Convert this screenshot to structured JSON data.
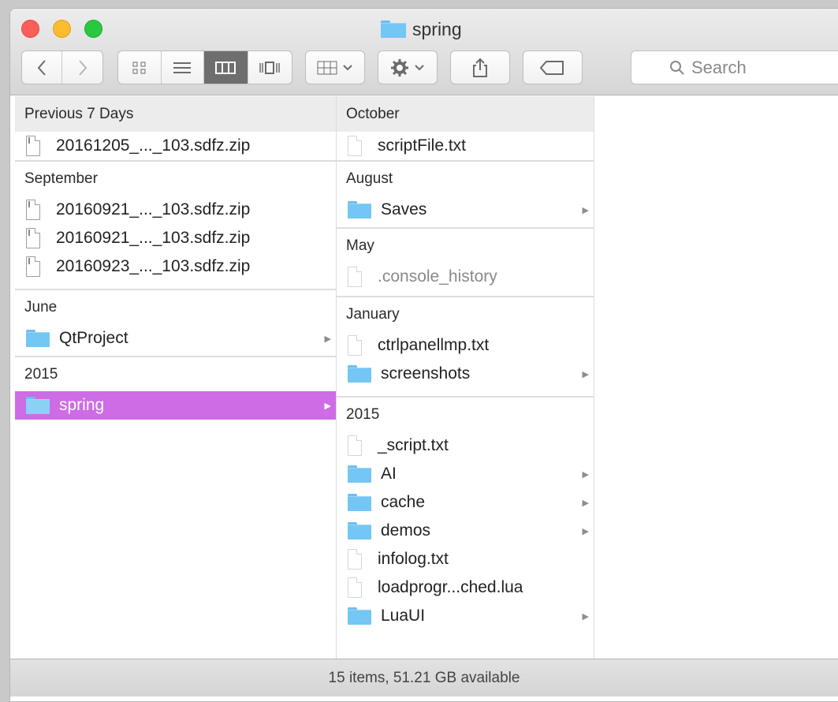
{
  "window": {
    "title": "spring"
  },
  "toolbar": {
    "back_icon": "chevron-left-icon",
    "forward_icon": "chevron-right-icon",
    "view_modes": [
      "icon-view-icon",
      "list-view-icon",
      "column-view-icon",
      "coverflow-view-icon"
    ],
    "active_view": "column-view-icon",
    "arrange_icon": "arrange-grid-icon",
    "action_icon": "gear-icon",
    "share_icon": "share-icon",
    "tag_icon": "tag-icon",
    "search_placeholder": "Search"
  },
  "column1": {
    "groups": [
      {
        "header": "Previous 7 Days",
        "items": [
          {
            "name": "20161205_..._103.sdfz.zip",
            "type": "zip"
          }
        ]
      },
      {
        "header": "September",
        "items": [
          {
            "name": "20160921_..._103.sdfz.zip",
            "type": "zip"
          },
          {
            "name": "20160921_..._103.sdfz.zip",
            "type": "zip"
          },
          {
            "name": "20160923_..._103.sdfz.zip",
            "type": "zip"
          }
        ]
      },
      {
        "header": "June",
        "items": [
          {
            "name": "QtProject",
            "type": "folder"
          }
        ]
      },
      {
        "header": "2015",
        "items": [
          {
            "name": "spring",
            "type": "folder",
            "selected": true
          }
        ]
      }
    ]
  },
  "column2": {
    "groups": [
      {
        "header": "October",
        "items": [
          {
            "name": "scriptFile.txt",
            "type": "doc"
          }
        ]
      },
      {
        "header": "August",
        "items": [
          {
            "name": "Saves",
            "type": "folder"
          }
        ]
      },
      {
        "header": "May",
        "items": [
          {
            "name": ".console_history",
            "type": "doc",
            "hidden": true
          }
        ]
      },
      {
        "header": "January",
        "items": [
          {
            "name": "ctrlpanellmp.txt",
            "type": "doc"
          },
          {
            "name": "screenshots",
            "type": "folder"
          }
        ]
      },
      {
        "header": "2015",
        "items": [
          {
            "name": "_script.txt",
            "type": "doc"
          },
          {
            "name": "AI",
            "type": "folder"
          },
          {
            "name": "cache",
            "type": "folder"
          },
          {
            "name": "demos",
            "type": "folder"
          },
          {
            "name": "infolog.txt",
            "type": "doc"
          },
          {
            "name": "loadprogr...ched.lua",
            "type": "doc"
          },
          {
            "name": "LuaUI",
            "type": "folder"
          }
        ]
      }
    ]
  },
  "statusbar": {
    "text": "15 items, 51.21 GB available"
  },
  "colors": {
    "selection": "#cd6ce5",
    "folder": "#74c6f4",
    "close": "#fc5f57",
    "minimize": "#fdbc2e",
    "maximize": "#28c940"
  }
}
